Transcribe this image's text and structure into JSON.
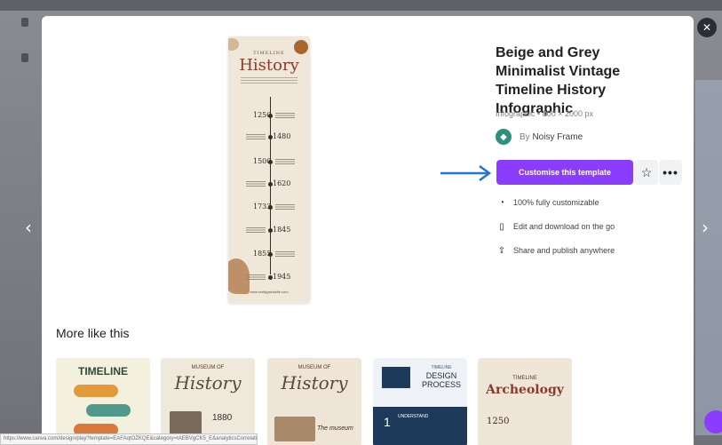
{
  "template": {
    "title": "Beige and Grey Minimalist Vintage Timeline History Infographic",
    "meta": "Infographic • 800 × 2000 px",
    "author_prefix": "By",
    "author_name": "Noisy Frame",
    "cta_label": "Customise this template",
    "more_label": "•••"
  },
  "features": [
    {
      "icon": "palette-icon",
      "label": "100% fully customizable"
    },
    {
      "icon": "phone-icon",
      "label": "Edit and download on the go"
    },
    {
      "icon": "share-icon",
      "label": "Share and publish anywhere"
    }
  ],
  "poster": {
    "kicker": "TIMELINE",
    "title": "History",
    "years": [
      "1250",
      "1480",
      "1500",
      "1620",
      "1733",
      "1845",
      "1855",
      "1945"
    ],
    "footer": "www.reallygreatsite.com"
  },
  "more_like_this": {
    "heading": "More like this",
    "thumbs": [
      {
        "title": "TIMELINE"
      },
      {
        "title": "History",
        "kicker": "MUSEUM OF",
        "number": "1880"
      },
      {
        "title": "History",
        "kicker": "MUSEUM OF",
        "caption": "The museum"
      },
      {
        "title": "DESIGN PROCESS",
        "kicker": "TIMELINE",
        "step_number": "1",
        "step_label": "UNDERSTAND"
      },
      {
        "title": "Archeology",
        "kicker": "TIMELINE",
        "number": "1250"
      }
    ]
  },
  "status_url": "https://www.canva.com/design/play?template=EAFAqtOZKQE&category=tAEBVgCK5_E&analyticsCorrelationId=...",
  "colors": {
    "accent": "#8b3dff",
    "arrow": "#1f77d0"
  }
}
